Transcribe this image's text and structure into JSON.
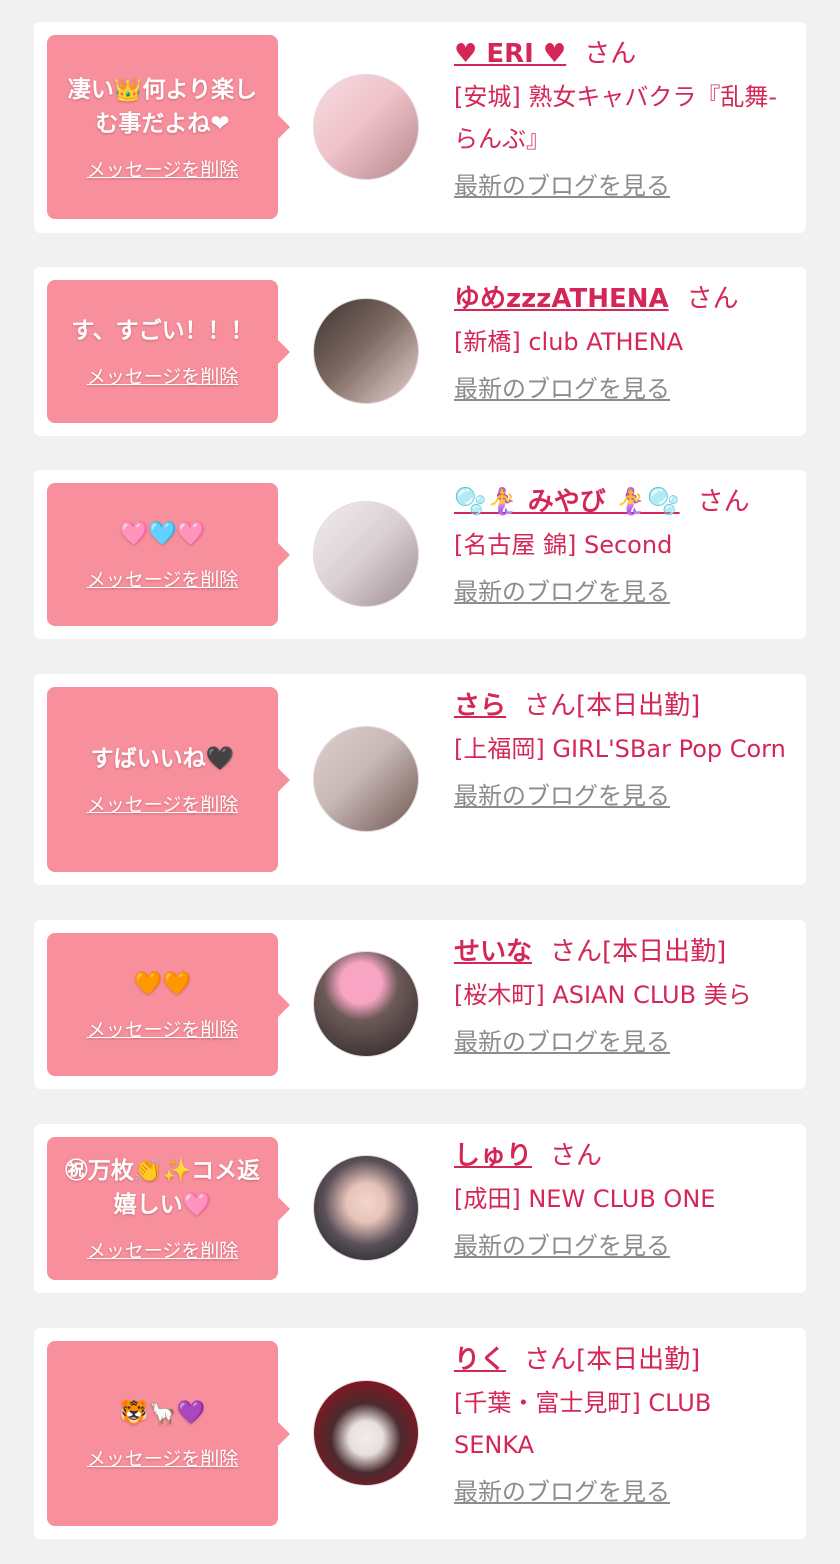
{
  "cards": [
    {
      "message": "凄い👑何より楽しむ事だよね❤",
      "delete_label": "メッセージを削除",
      "name": "♥ ERI ♥",
      "honorific": "さん",
      "shop": "[安城] 熟女キャバクラ『乱舞-らんぶ』",
      "blog_link": "最新のブログを見る",
      "avatar_colors": [
        "#f3c9cf",
        "#b4868c"
      ]
    },
    {
      "message": "す、すごい！！！",
      "delete_label": "メッセージを削除",
      "name": "ゆめzzzATHENA",
      "honorific": "さん",
      "shop": "[新橋] club ATHENA",
      "blog_link": "最新のブログを見る",
      "avatar_colors": [
        "#5b4d47",
        "#e9d4ce"
      ]
    },
    {
      "message": "🩷🩵🩷",
      "delete_label": "メッセージを削除",
      "name": "🫧🧜‍♀️ みやび 🧜‍♀️🫧",
      "honorific": "さん",
      "shop": "[名古屋 錦] Second",
      "blog_link": "最新のブログを見る",
      "avatar_colors": [
        "#ece6ea",
        "#9d8c8f"
      ]
    },
    {
      "message": "すばいいね🖤",
      "delete_label": "メッセージを削除",
      "name": "さら",
      "honorific": "さん[本日出勤]",
      "shop": "[上福岡] GIRL'SBar Pop Corn",
      "blog_link": "最新のブログを見る",
      "avatar_colors": [
        "#c7b7b5",
        "#6f5752"
      ]
    },
    {
      "message": "🧡🧡",
      "delete_label": "メッセージを削除",
      "name": "せいな",
      "honorific": "さん[本日出勤]",
      "shop": "[桜木町] ASIAN CLUB 美ら",
      "blog_link": "最新のブログを見る",
      "avatar_colors": [
        "#f8a4c3",
        "#403636"
      ]
    },
    {
      "message": "㊗万枚👏✨コメ返嬉しい🩷",
      "delete_label": "メッセージを削除",
      "name": "しゅり",
      "honorific": "さん",
      "shop": "[成田] NEW CLUB ONE",
      "blog_link": "最新のブログを見る",
      "avatar_colors": [
        "#2a2a30",
        "#e7c3b8"
      ]
    },
    {
      "message": "🐯🦙💜",
      "delete_label": "メッセージを削除",
      "name": "りく",
      "honorific": "さん[本日出勤]",
      "shop": "[千葉・富士見町] CLUB SENKA",
      "blog_link": "最新のブログを見る",
      "avatar_colors": [
        "#8a1420",
        "#e7e0de"
      ]
    }
  ]
}
